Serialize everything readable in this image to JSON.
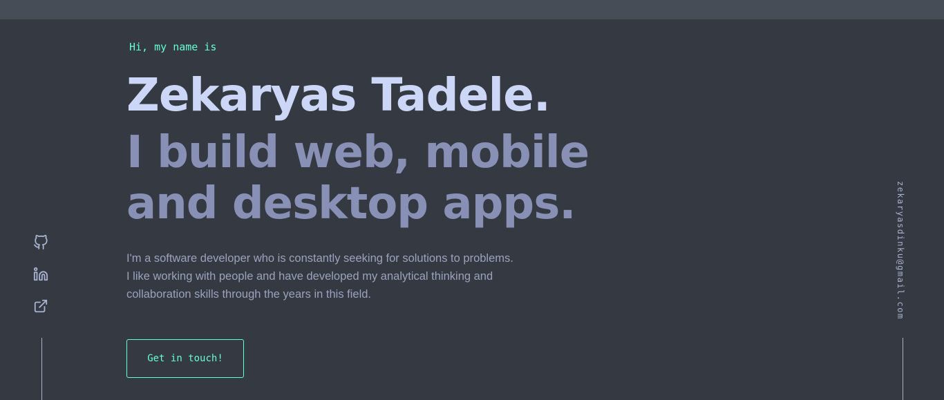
{
  "hero": {
    "greeting": "Hi, my name is",
    "name": "Zekaryas Tadele.",
    "tagline": "I build web, mobile and desktop apps.",
    "bio": "I'm a software developer who is constantly seeking for solutions to problems. I like working with people and have developed my analytical thinking and collaboration skills through the years in this field.",
    "cta_label": "Get in touch!"
  },
  "social": {
    "icons": [
      "github-icon",
      "linkedin-icon",
      "external-link-icon"
    ]
  },
  "contact": {
    "email": "zekaryasdinku@gmail.com"
  },
  "colors": {
    "background": "#353942",
    "topbar": "#474d56",
    "accent": "#64ffda",
    "name": "#ccd6f6",
    "tagline": "#8890b5",
    "text": "#9aa3bd",
    "lines": "#a8b2d1"
  }
}
